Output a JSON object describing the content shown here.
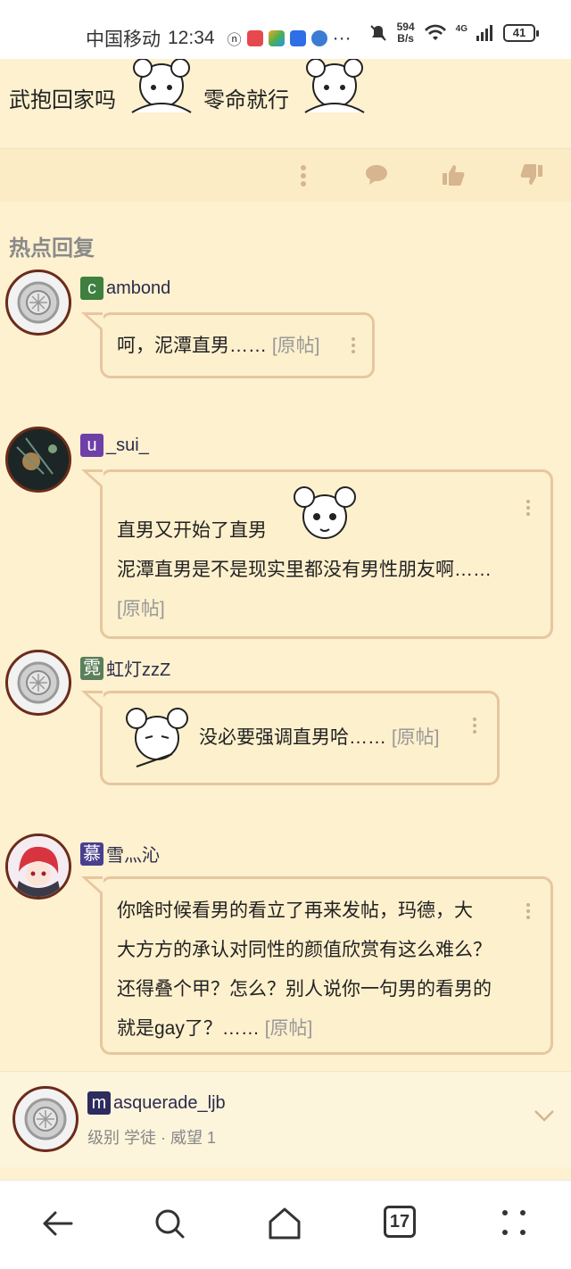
{
  "status_bar": {
    "carrier": "中国移动",
    "time": "12:34",
    "net_speed_top": "594",
    "net_speed_bottom": "B/s",
    "signal_label": "4G",
    "battery": "41"
  },
  "top_post": {
    "text_a": "武抱回家吗",
    "text_b": "零命就行"
  },
  "hot_replies": {
    "title": "热点回复",
    "original_label": "[原帖]",
    "replies": [
      {
        "badge": "c",
        "badge_color": "#3f7f3f",
        "name": "ambond",
        "lines": [
          "呵，泥潭直男……"
        ]
      },
      {
        "badge": "u",
        "badge_color": "#6f3fa8",
        "name": "_sui_",
        "lines": [
          "直男又开始了直男",
          "泥潭直男是不是现实里都没有男性朋友啊……"
        ]
      },
      {
        "badge": "霓",
        "badge_color": "#5b7f5b",
        "name": "虹灯zzZ",
        "lines": [
          "没必要强调直男哈……"
        ]
      },
      {
        "badge": "慕",
        "badge_color": "#4a3f8f",
        "name": "雪灬沁",
        "lines": [
          "你啥时候看男的看立了再来发帖，玛德，大",
          "大方方的承认对同性的颜值欣赏有这么难么？",
          "还得叠个甲？怎么？别人说你一句男的看男的",
          "就是gay了？……"
        ]
      }
    ]
  },
  "author": {
    "badge": "m",
    "badge_color": "#2c2c5e",
    "name": "asquerade_ljb",
    "meta": "级别 学徒 · 威望 1"
  },
  "navbar": {
    "tabs_count": "17"
  },
  "colors": {
    "background": "#fdf1cf",
    "bubble_border": "#e7c69f",
    "avatar_border": "#6b2b1b"
  }
}
